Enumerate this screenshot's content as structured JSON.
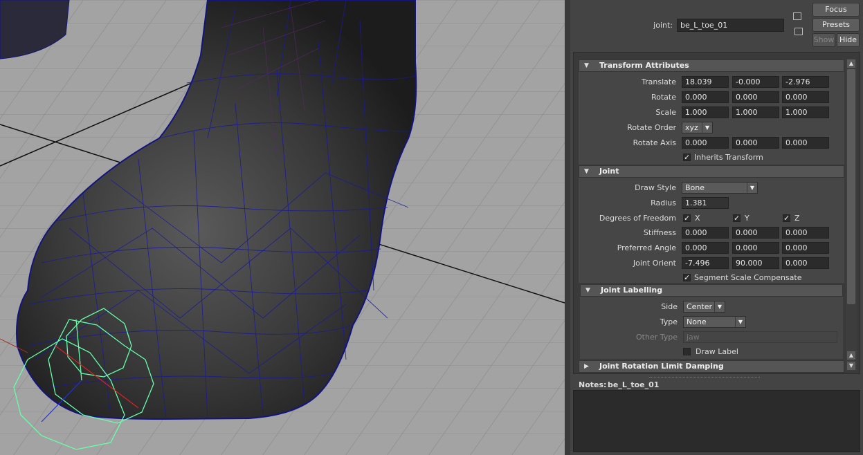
{
  "joint_field": {
    "label": "joint:",
    "value": "be_L_toe_01"
  },
  "buttons": {
    "focus": "Focus",
    "presets": "Presets",
    "show": "Show",
    "hide": "Hide"
  },
  "transform": {
    "header": "Transform Attributes",
    "translate": {
      "label": "Translate",
      "x": "18.039",
      "y": "-0.000",
      "z": "-2.976"
    },
    "rotate": {
      "label": "Rotate",
      "x": "0.000",
      "y": "0.000",
      "z": "0.000"
    },
    "scale": {
      "label": "Scale",
      "x": "1.000",
      "y": "1.000",
      "z": "1.000"
    },
    "rotate_order": {
      "label": "Rotate Order",
      "value": "xyz"
    },
    "rotate_axis": {
      "label": "Rotate Axis",
      "x": "0.000",
      "y": "0.000",
      "z": "0.000"
    },
    "inherits": {
      "label": "Inherits Transform",
      "checked": true
    }
  },
  "joint": {
    "header": "Joint",
    "draw_style": {
      "label": "Draw Style",
      "value": "Bone"
    },
    "radius": {
      "label": "Radius",
      "value": "1.381"
    },
    "dof": {
      "label": "Degrees of Freedom",
      "x": "X",
      "y": "Y",
      "z": "Z"
    },
    "stiffness": {
      "label": "Stiffness",
      "x": "0.000",
      "y": "0.000",
      "z": "0.000"
    },
    "preferred_angle": {
      "label": "Preferred Angle",
      "x": "0.000",
      "y": "0.000",
      "z": "0.000"
    },
    "joint_orient": {
      "label": "Joint Orient",
      "x": "-7.496",
      "y": "90.000",
      "z": "0.000"
    },
    "ssc": {
      "label": "Segment Scale Compensate",
      "checked": true
    }
  },
  "labelling": {
    "header": "Joint Labelling",
    "side": {
      "label": "Side",
      "value": "Center"
    },
    "type": {
      "label": "Type",
      "value": "None"
    },
    "other_type": {
      "label": "Other Type",
      "placeholder": "jaw"
    },
    "draw_label": {
      "label": "Draw Label",
      "checked": false
    }
  },
  "rotation_limit": {
    "header": "Joint Rotation Limit Damping"
  },
  "notes": {
    "label": "Notes:",
    "value": "be_L_toe_01"
  },
  "colors": {
    "viewport_bg": "#a3a3a3",
    "panel_bg": "#444444",
    "field_bg": "#2b2b2b",
    "wire": "#1a1a9a",
    "joint": "#66ffaa"
  },
  "icons": [
    "expand-triangle-icon",
    "collapse-triangle-icon",
    "checkmark-icon",
    "dropdown-arrow-icon",
    "load-attribute-icon"
  ]
}
